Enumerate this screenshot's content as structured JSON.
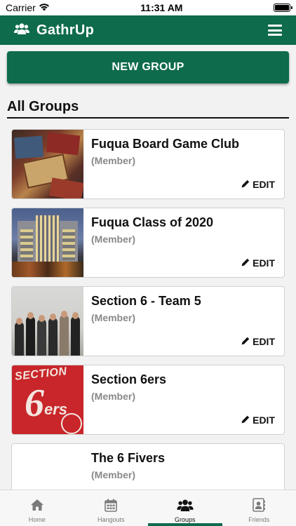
{
  "status_bar": {
    "carrier": "Carrier",
    "time": "11:31 AM"
  },
  "header": {
    "title": "GathrUp",
    "logo_icon": "users-icon",
    "menu_icon": "hamburger-menu-icon"
  },
  "new_group_label": "NEW GROUP",
  "section_title": "All Groups",
  "groups": [
    {
      "name": "Fuqua Board Game Club",
      "role": "(Member)",
      "edit_label": "EDIT",
      "thumb": "board-games-photo"
    },
    {
      "name": "Fuqua Class of 2020",
      "role": "(Member)",
      "edit_label": "EDIT",
      "thumb": "building-photo"
    },
    {
      "name": "Section 6 - Team 5",
      "role": "(Member)",
      "edit_label": "EDIT",
      "thumb": "team-photo"
    },
    {
      "name": "Section 6ers",
      "role": "(Member)",
      "edit_label": "EDIT",
      "thumb": "shirt-photo"
    },
    {
      "name": "The 6 Fivers",
      "role": "(Member)",
      "edit_label": "",
      "thumb": "blank"
    }
  ],
  "thumb_text": {
    "shirt_top": "SECTION",
    "shirt_six": "6",
    "shirt_ers": "ers"
  },
  "tabs": [
    {
      "label": "Home",
      "icon": "home-icon"
    },
    {
      "label": "Hangouts",
      "icon": "calendar-icon"
    },
    {
      "label": "Groups",
      "icon": "groups-icon",
      "active": true
    },
    {
      "label": "Friends",
      "icon": "friends-contact-icon"
    }
  ],
  "colors": {
    "brand_green": "#0e6b4c",
    "background": "#f2f2f2",
    "muted_text": "#888888"
  }
}
